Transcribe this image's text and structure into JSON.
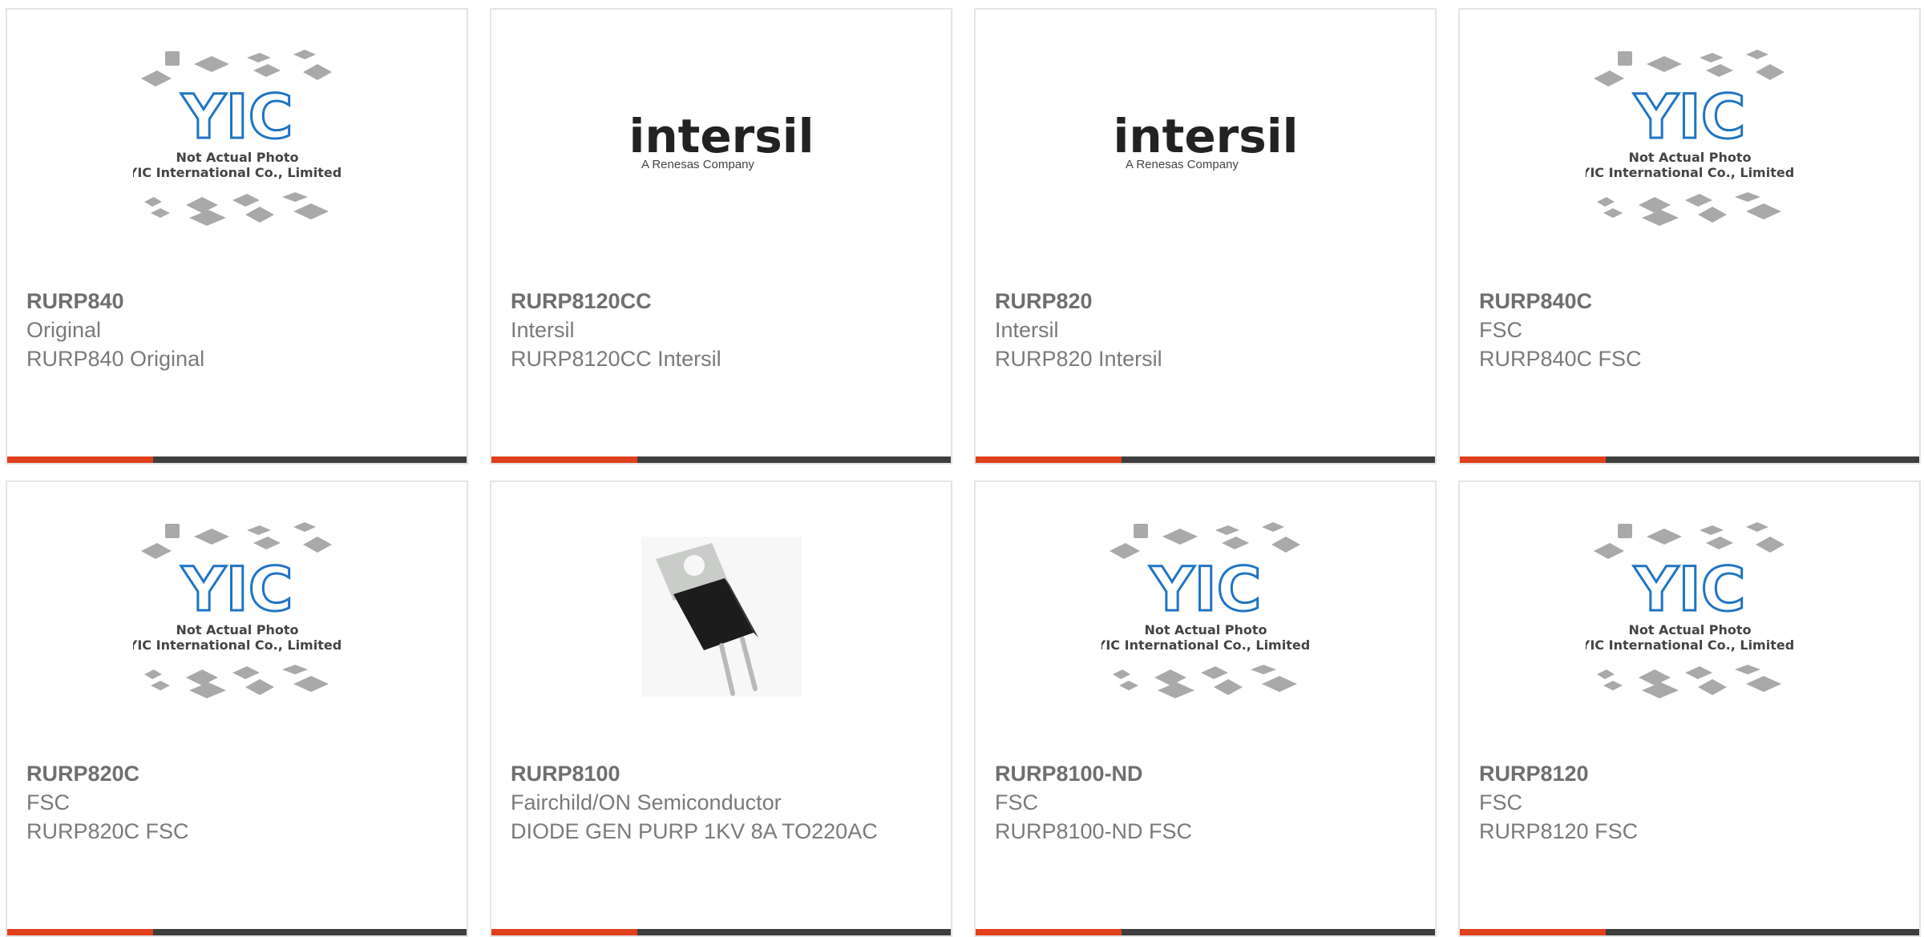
{
  "products": [
    {
      "part": "RURP840",
      "brand": "Original",
      "desc": "RURP840 Original",
      "image": "placeholder"
    },
    {
      "part": "RURP8120CC",
      "brand": "Intersil",
      "desc": "RURP8120CC Intersil",
      "image": "intersil-logo"
    },
    {
      "part": "RURP820",
      "brand": "Intersil",
      "desc": "RURP820 Intersil",
      "image": "intersil-logo"
    },
    {
      "part": "RURP840C",
      "brand": "FSC",
      "desc": "RURP840C FSC",
      "image": "placeholder"
    },
    {
      "part": "RURP820C",
      "brand": "FSC",
      "desc": "RURP820C FSC",
      "image": "placeholder"
    },
    {
      "part": "RURP8100",
      "brand": "Fairchild/ON Semiconductor",
      "desc": "DIODE GEN PURP 1KV 8A TO220AC",
      "image": "to220-photo"
    },
    {
      "part": "RURP8100-ND",
      "brand": "FSC",
      "desc": "RURP8100-ND FSC",
      "image": "placeholder"
    },
    {
      "part": "RURP8120",
      "brand": "FSC",
      "desc": "RURP8120 FSC",
      "image": "placeholder"
    }
  ],
  "placeholder": {
    "logo": "YIC",
    "caption1": "Not Actual Photo",
    "caption2": "YIC International Co., Limited."
  },
  "intersil": {
    "name": "intersil",
    "tagline": "A Renesas Company"
  },
  "colors": {
    "accent": "#e0401b",
    "bar": "#3e3e3e",
    "yic_blue": "#1f74c4",
    "text": "#7a7a7a"
  }
}
